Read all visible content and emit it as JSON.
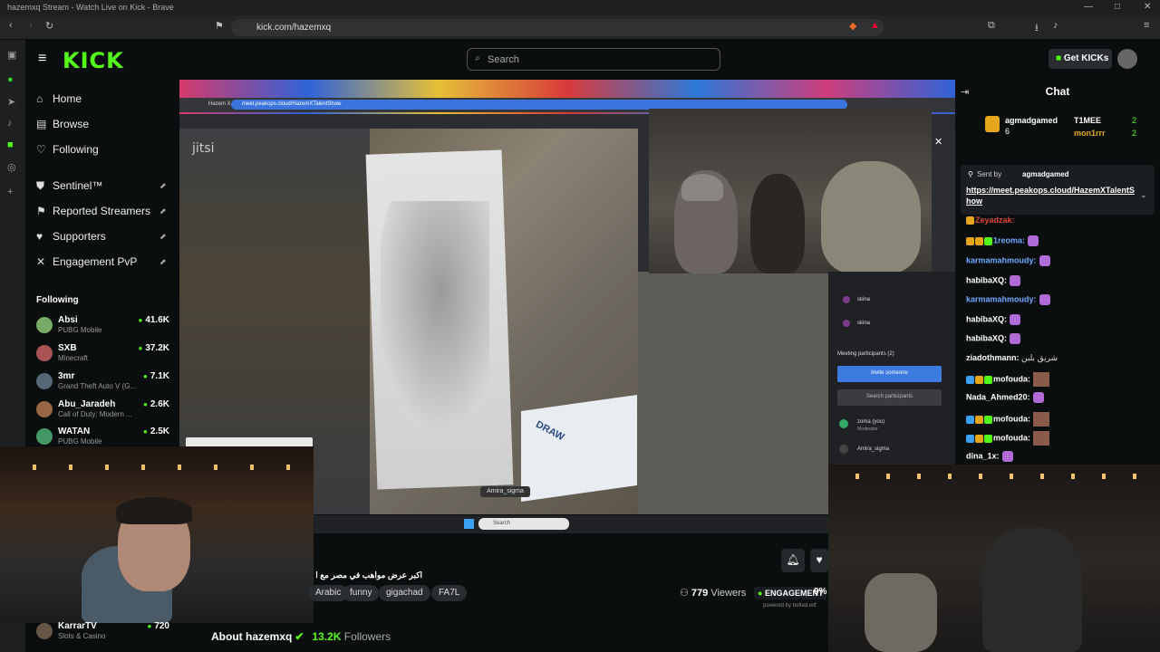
{
  "browser": {
    "window_title": "hazemxq Stream - Watch Live on Kick - Brave",
    "url": "kick.com/hazemxq"
  },
  "kick": {
    "logo": "KICK",
    "search_placeholder": "Search",
    "get_kicks": "Get KICKs"
  },
  "nav": {
    "home": "Home",
    "browse": "Browse",
    "following": "Following",
    "sentinel": "Sentinel™",
    "reported": "Reported Streamers",
    "supporters": "Supporters",
    "engagement": "Engagement PvP"
  },
  "following_section": {
    "title": "Following",
    "items": [
      {
        "name": "Absi",
        "game": "PUBG Mobile",
        "viewers": "41.6K"
      },
      {
        "name": "SXB",
        "game": "Minecraft",
        "viewers": "37.2K"
      },
      {
        "name": "3mr",
        "game": "Grand Theft Auto V (G...",
        "viewers": "7.1K"
      },
      {
        "name": "Abu_Jaradeh",
        "game": "Call of Duty: Modern ...",
        "viewers": "2.6K"
      },
      {
        "name": "WATAN",
        "game": "PUBG Mobile",
        "viewers": "2.5K"
      },
      {
        "name": "KarrarTV",
        "game": "Slots & Casino",
        "viewers": "720"
      }
    ]
  },
  "stream": {
    "jitsi": "jitsi",
    "inner_url": "meet.peakops.cloud/HazemXTalentShow",
    "inner_tab": "Hazem X Talent Show | Jit",
    "participant_name": "Amira_sigma",
    "box_text": "DRAW",
    "participants": {
      "p1": "skina",
      "p2": "skina",
      "header": "Meeting participants (2)",
      "invite": "Invite someone",
      "search": "Search participants",
      "me": "zoma (you)",
      "me_role": "Moderator",
      "other": "Amira_sigma"
    },
    "taskbar_search": "Search"
  },
  "info": {
    "title": "اكبر عرض مواهب في مصر مع ا",
    "tags": [
      "Arabic",
      "funny",
      "gigachad",
      "FA7L"
    ],
    "viewers_count": "779",
    "viewers_label": "Viewers",
    "engagement_label": "ENGAGEMENT",
    "engagement_pct": "9%",
    "powered": "powered by botted.wtf",
    "about": "About hazemxq",
    "followers_count": "13.2K",
    "followers_label": "Followers"
  },
  "chat": {
    "title": "Chat",
    "leaders": [
      {
        "name": "agmadgamed",
        "count": "6"
      },
      {
        "name": "T1MEE",
        "count": "2"
      },
      {
        "name": "mon1rrr",
        "count": "2"
      }
    ],
    "pinned_sender_label": "Sent by",
    "pinned_sender": "agmadgamed",
    "pinned_link": "https://meet.peakops.cloud/HazemXTalentShow",
    "messages": [
      {
        "user": "Zeyadzak:",
        "color": "#e0463a"
      },
      {
        "user": "1reoma:",
        "color": "#6fa8ff"
      },
      {
        "user": "karmamahmoudy:",
        "color": "#6fa8ff"
      },
      {
        "user": "habibaXQ:",
        "color": "#ffffff"
      },
      {
        "user": "karmamahmoudy:",
        "color": "#6fa8ff"
      },
      {
        "user": "habibaXQ:",
        "color": "#ffffff"
      },
      {
        "user": "habibaXQ:",
        "color": "#ffffff"
      },
      {
        "user": "ziadothmann:",
        "color": "#ffffff",
        "text": "شريق بلبن"
      },
      {
        "user": "mofouda:",
        "color": "#ffffff"
      },
      {
        "user": "Nada_Ahmed20:",
        "color": "#ffffff"
      },
      {
        "user": "mofouda:",
        "color": "#ffffff"
      },
      {
        "user": "mofouda:",
        "color": "#ffffff"
      },
      {
        "user": "dina_1x:",
        "color": "#ffffff"
      }
    ]
  },
  "colors": {
    "kick_green": "#53fc18",
    "background": "#0b0e0f"
  }
}
